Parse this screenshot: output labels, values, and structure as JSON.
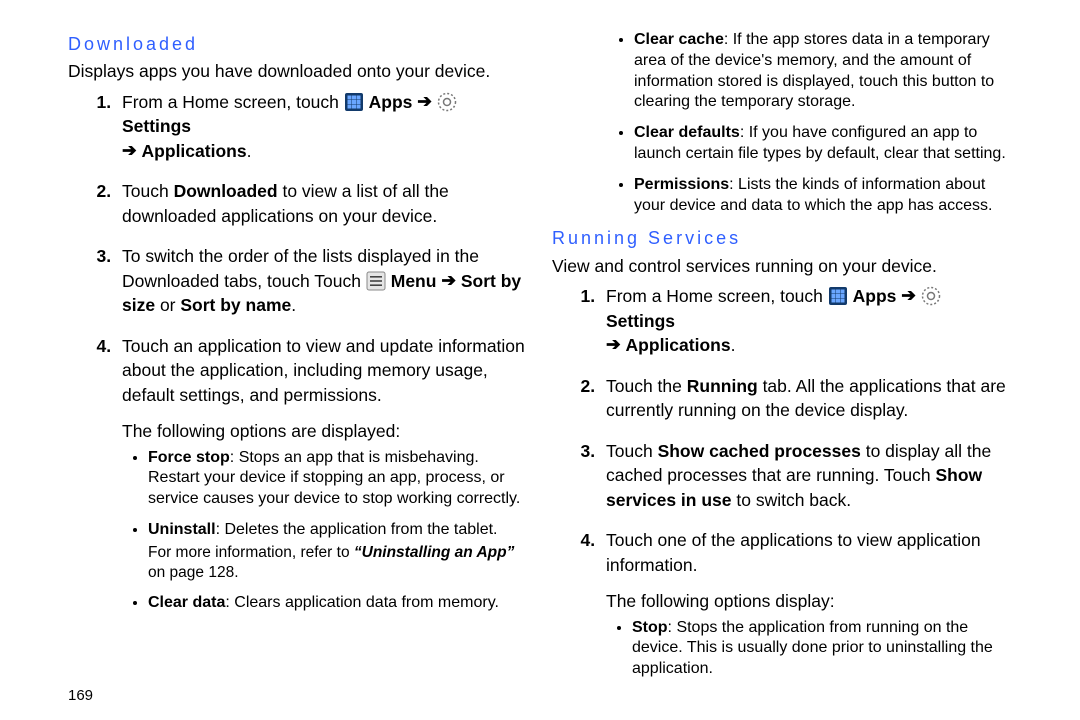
{
  "left": {
    "heading": "Downloaded",
    "intro": "Displays apps you have downloaded onto your device.",
    "step1_pre": "From a Home screen, touch ",
    "apps_label": "Apps",
    "arrow": "➔",
    "settings_label": "Settings",
    "applications_label": "Applications",
    "step2_a": "Touch ",
    "step2_b": "Downloaded",
    "step2_c": " to view a list of all the downloaded applications on your device.",
    "step3_a": "To switch the order of the lists displayed in the Downloaded tabs, touch Touch ",
    "step3_menu": "Menu",
    "step3_sortby": "Sort by size",
    "step3_or": " or ",
    "step3_sortname": "Sort by name",
    "step3_dot": ".",
    "step4": "Touch an application to view and update information about the application, including memory usage, default settings, and permissions.",
    "options_intro": "The following options are displayed:",
    "opt_force_label": "Force stop",
    "opt_force_text": ": Stops an app that is misbehaving. Restart your device if stopping an app, process, or service causes your device to stop working correctly.",
    "opt_uninstall_label": "Uninstall",
    "opt_uninstall_text": ": Deletes the application from the tablet.",
    "opt_uninstall_ref_a": "For more information, refer to ",
    "opt_uninstall_ref_b": "“Uninstalling an App”",
    "opt_uninstall_ref_c": "  on page 128.",
    "opt_cleardata_label": "Clear data",
    "opt_cleardata_text": ": Clears application data from memory."
  },
  "right": {
    "cont_cc_label": "Clear cache",
    "cont_cc_text": ": If the app stores data in a temporary area of the device's memory, and the amount of information stored is displayed, touch this button to clearing the temporary storage.",
    "cont_cd_label": "Clear defaults",
    "cont_cd_text": ": If you have configured an app to launch certain file types by default, clear that setting.",
    "cont_perm_label": "Permissions",
    "cont_perm_text": ": Lists the kinds of information about your device and data to which the app has access.",
    "heading": "Running Services",
    "intro": "View and control services running on your device.",
    "step1_pre": "From a Home screen, touch ",
    "apps_label": "Apps",
    "arrow": "➔",
    "settings_label": "Settings",
    "applications_label": "Applications",
    "step2_a": "Touch the ",
    "step2_b": "Running",
    "step2_c": " tab. All the applications that are currently running on the device display.",
    "step3_a": "Touch ",
    "step3_b": "Show cached processes",
    "step3_c": " to display all the cached processes that are running. Touch ",
    "step3_d": "Show services in use",
    "step3_e": " to switch back.",
    "step4": "Touch one of the applications to view application information.",
    "options_intro": "The following options display:",
    "opt_stop_label": "Stop",
    "opt_stop_text": ": Stops the application from running on the device. This is usually done prior to uninstalling the application."
  },
  "page_number": "169"
}
